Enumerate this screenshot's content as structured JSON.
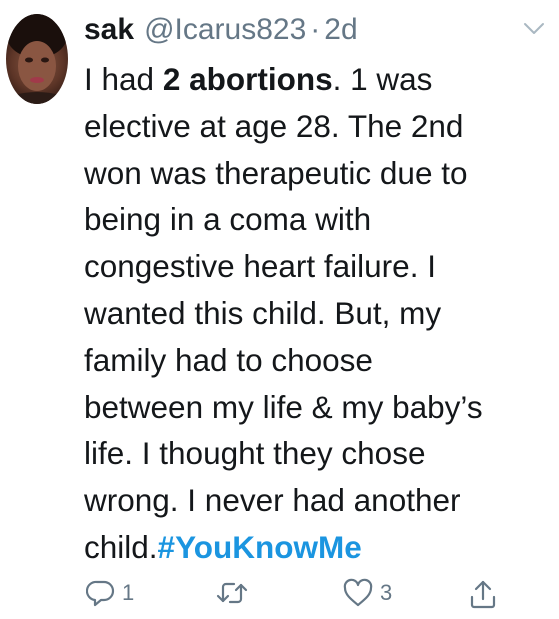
{
  "user": {
    "name": "sak",
    "handle": "@Icarus823",
    "separator": "·",
    "time": "2d"
  },
  "tweet": {
    "lines": [
      {
        "pre": "I had ",
        "bold": "2 abortions",
        "post": ". 1 was"
      },
      {
        "text": "elective at age 28. The 2nd"
      },
      {
        "text": "won was therapeutic due to"
      },
      {
        "text": "being in a coma with"
      },
      {
        "text": "congestive heart failure. I"
      },
      {
        "text": "wanted this child. But, my"
      },
      {
        "text": "family had to choose"
      },
      {
        "text": "between my life & my baby’s"
      },
      {
        "text": "life. I thought they chose"
      },
      {
        "text": "wrong. I never had another"
      },
      {
        "pre": "child.",
        "hashtag": "#YouKnowMe"
      }
    ]
  },
  "actions": {
    "reply_count": "1",
    "retweet_count": "",
    "like_count": "3"
  },
  "colors": {
    "text": "#14171a",
    "muted": "#657786",
    "hashtag": "#1b95e0"
  },
  "icons": [
    "caret-down-icon",
    "reply-icon",
    "retweet-icon",
    "like-icon",
    "share-icon"
  ]
}
